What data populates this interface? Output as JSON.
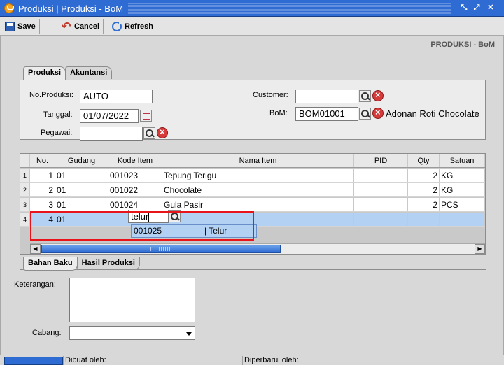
{
  "window": {
    "title": "Produksi | Produksi - BoM"
  },
  "toolbar": {
    "save_label": "Save",
    "cancel_label": "Cancel",
    "refresh_label": "Refresh"
  },
  "page_title": "PRODUKSI - BoM",
  "top_tabs": [
    "Produksi",
    "Akuntansi"
  ],
  "form": {
    "no_produksi_label": "No.Produksi:",
    "no_produksi_value": "AUTO",
    "tanggal_label": "Tanggal:",
    "tanggal_value": "01/07/2022",
    "pegawai_label": "Pegawai:",
    "pegawai_value": "",
    "customer_label": "Customer:",
    "customer_value": "",
    "bom_label": "BoM:",
    "bom_value": "BOM01001",
    "bom_name": "Adonan Roti Chocolate"
  },
  "grid": {
    "headers": [
      "No.",
      "Gudang",
      "Kode Item",
      "Nama Item",
      "PID",
      "Qty",
      "Satuan"
    ],
    "rows": [
      {
        "rn": "1",
        "no": "1",
        "gudang": "01",
        "kode": "001023",
        "nama": "Tepung Terigu",
        "pid": "",
        "qty": "2",
        "satuan": "KG"
      },
      {
        "rn": "2",
        "no": "2",
        "gudang": "01",
        "kode": "001022",
        "nama": "Chocolate",
        "pid": "",
        "qty": "2",
        "satuan": "KG"
      },
      {
        "rn": "3",
        "no": "3",
        "gudang": "01",
        "kode": "001024",
        "nama": "Gula Pasir",
        "pid": "",
        "qty": "2",
        "satuan": "PCS"
      },
      {
        "rn": "4",
        "no": "4",
        "gudang": "01",
        "kode": "",
        "nama": "",
        "pid": "",
        "qty": "",
        "satuan": ""
      }
    ],
    "editor_value": "telur",
    "suggestion": {
      "code": "001025",
      "name": "| Telur"
    }
  },
  "bottom_tabs": [
    "Bahan Baku",
    "Hasil Produksi"
  ],
  "bottom": {
    "keterangan_label": "Keterangan:",
    "cabang_label": "Cabang:",
    "cabang_value": ""
  },
  "status": {
    "dibuat_label": "Dibuat oleh:",
    "diperbarui_label": "Diperbarui oleh:"
  },
  "colors": {
    "title_bar": "#2e6bd3",
    "selection": "#b3d1f3",
    "highlight": "#e8141a"
  }
}
